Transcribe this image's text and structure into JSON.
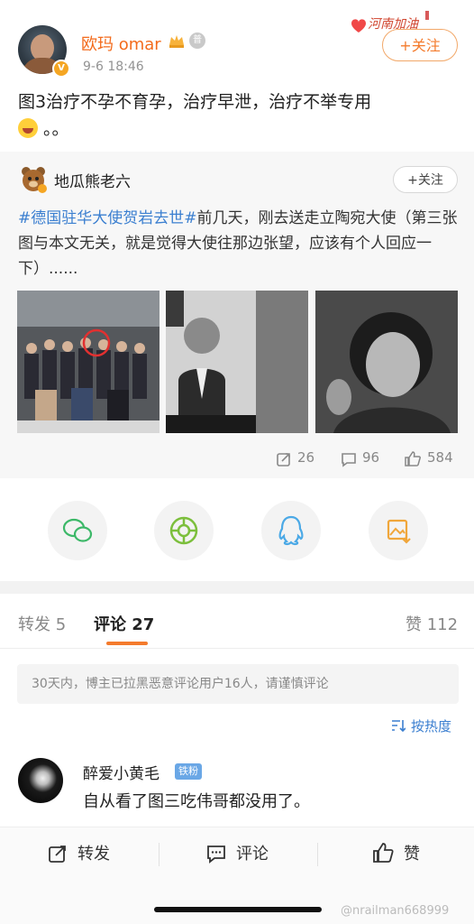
{
  "post": {
    "author": "欧玛 omar",
    "verified_badge": "V",
    "medal_text": "普",
    "time": "9-6 18:46",
    "follow_label": "+关注",
    "text_line1": "图3治疗不孕不育孕，治疗早泄，治疗不举专用",
    "text_line2": "。。",
    "top_banner": "河南加油"
  },
  "repost": {
    "author": "地瓜熊老六",
    "follow_label": "+关注",
    "tag": "#德国驻华大使贺岩去世#",
    "text": "前几天，刚去送走立陶宛大使（第三张图与本文无关，就是觉得大使往那边张望，应该有个人回应一下）......",
    "stats": {
      "reposts": "26",
      "comments": "96",
      "likes": "584"
    }
  },
  "share_icons": [
    "wechat-icon",
    "moments-icon",
    "qq-icon",
    "save-image-icon"
  ],
  "tabs": {
    "repost": "转发 5",
    "comment": "评论 27",
    "likes": "赞 112"
  },
  "notice": "30天内，博主已拉黑恶意评论用户16人，请谨慎评论",
  "sort_label": "按热度",
  "comment": {
    "author": "醉爱小黄毛",
    "badge": "铁粉",
    "text": "自从看了图三吃伟哥都没用了。"
  },
  "bottom_bar": {
    "repost": "转发",
    "comment": "评论",
    "like": "赞"
  },
  "watermark": "@nrailman668999",
  "colors": {
    "accent": "#f47b2c",
    "link": "#3b7fd0"
  }
}
